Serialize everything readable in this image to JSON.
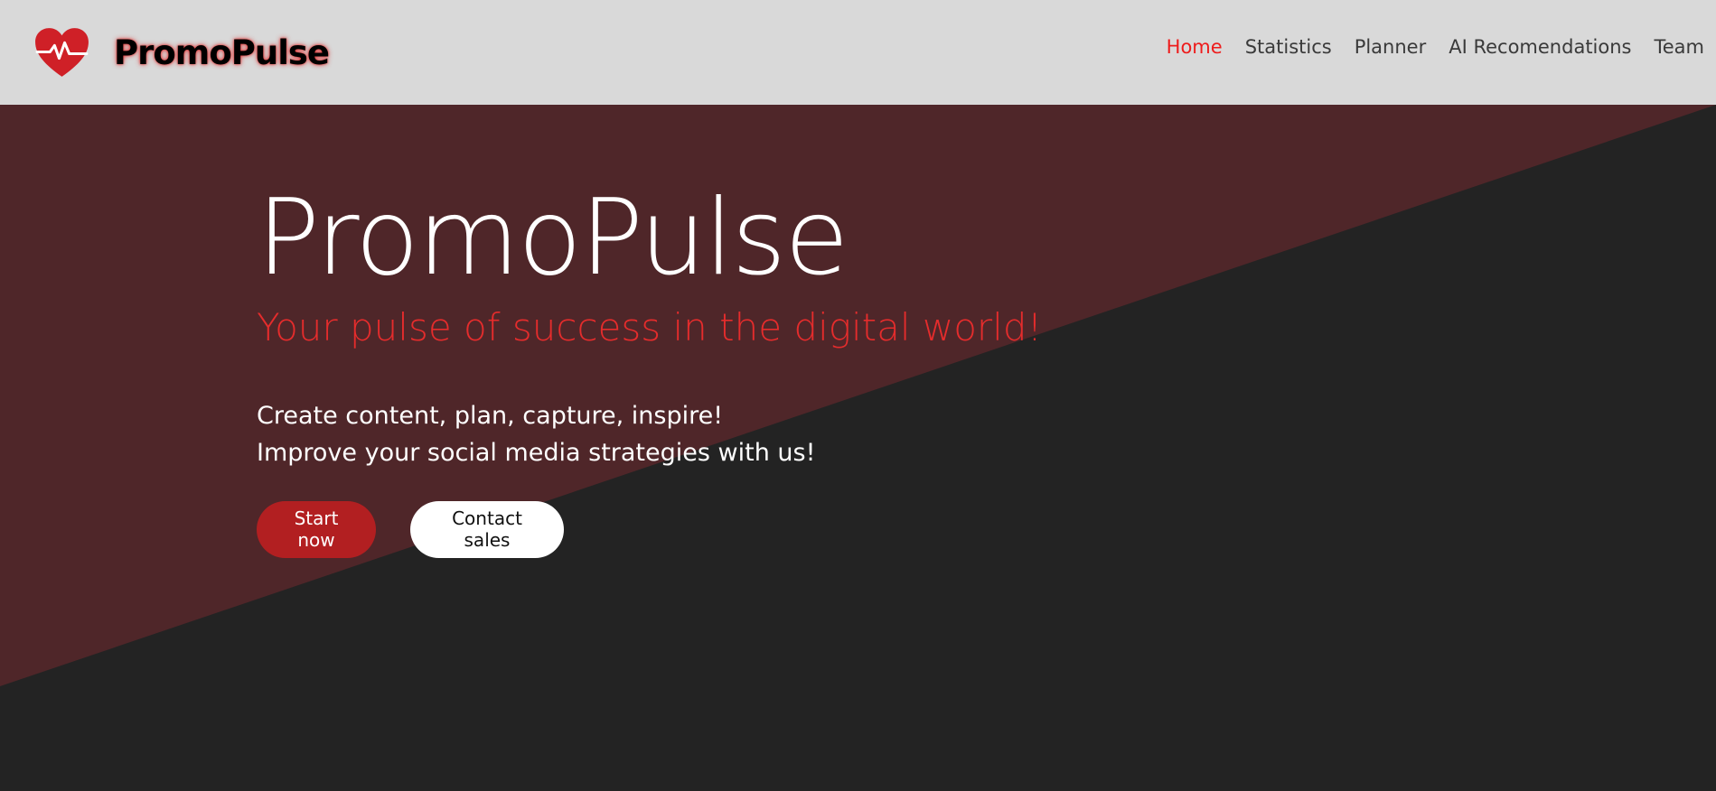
{
  "header": {
    "brand_name": "PromoPulse",
    "logo_icon": "heart-pulse-icon",
    "nav_items": [
      {
        "label": "Home",
        "active": true
      },
      {
        "label": "Statistics",
        "active": false
      },
      {
        "label": "Planner",
        "active": false
      },
      {
        "label": "AI Recomendations",
        "active": false
      },
      {
        "label": "Team",
        "active": false
      }
    ]
  },
  "hero": {
    "title": "PromoPulse",
    "tagline": "Your pulse of success in the digital world!",
    "lines": [
      "Create content, plan, capture, inspire!",
      "Improve your social media strategies with us!"
    ],
    "primary_button": "Start now",
    "secondary_button": "Contact sales"
  },
  "colors": {
    "header_bg": "#d9d9d9",
    "hero_dark": "#232323",
    "hero_wedge": "#4f2629",
    "accent_red": "#ee1c1c",
    "button_red": "#b21f21",
    "white": "#ffffff"
  }
}
